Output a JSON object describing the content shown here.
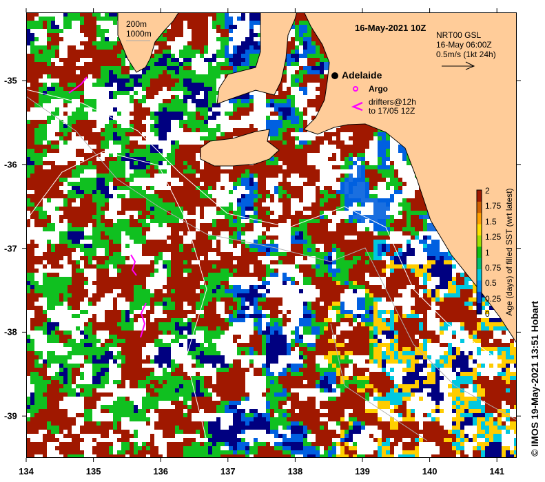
{
  "title": "16-May-2021 10Z",
  "current_legend": {
    "line1": "NRT00 GSL",
    "line2": "16-May 06:00Z",
    "line3": "0.5m/s (1kt 24h)"
  },
  "depth_legend": {
    "shallow": "200m",
    "deep": "1000m"
  },
  "places": [
    {
      "name": "Adelaide",
      "icon": "city-dot-icon"
    }
  ],
  "markers": {
    "argo_label": "Argo",
    "drifters_line1": "drifters@12h",
    "drifters_line2": "to 17/05 12Z",
    "argo_color": "#ff00ff",
    "drifter_color": "#ff00ff"
  },
  "x_axis": {
    "ticks": [
      "134",
      "135",
      "136",
      "137",
      "138",
      "139",
      "140",
      "141"
    ]
  },
  "y_axis": {
    "ticks": [
      "-35",
      "-36",
      "-37",
      "-38",
      "-39"
    ]
  },
  "colorbar": {
    "label": "Age (days) of filled SST (wrt latest)",
    "ticks": [
      "2",
      "1.75",
      "1.5",
      "1.25",
      "1",
      "0.75",
      "0.5",
      "0.25",
      "0"
    ],
    "range": [
      0,
      2
    ],
    "colors": [
      "#000080",
      "#0040d0",
      "#0090f0",
      "#00c8e0",
      "#00c070",
      "#10c010",
      "#a0e000",
      "#ffe000",
      "#ffa000",
      "#d06000",
      "#a01800"
    ]
  },
  "credit": "© IMOS 19-May-2021 13:51 Hobart",
  "colors": {
    "land": "#ffcc99",
    "missing": "#ffffff"
  }
}
